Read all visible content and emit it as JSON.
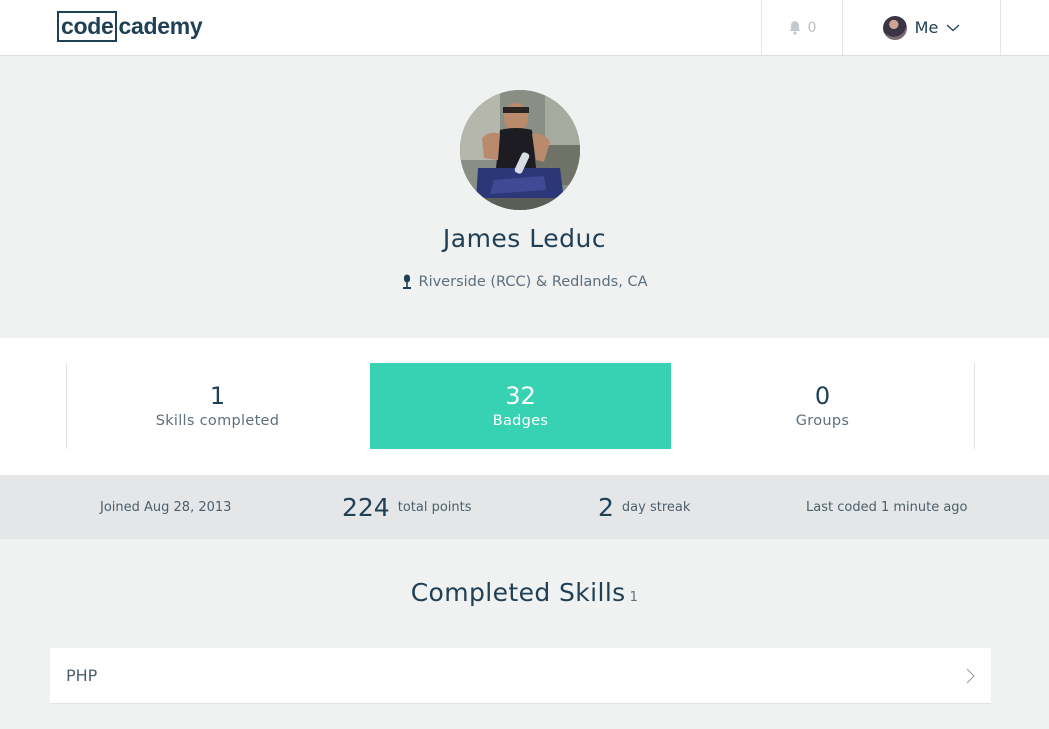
{
  "header": {
    "logo_code": "code",
    "logo_rest": "cademy",
    "notifications_count": "0",
    "me_label": "Me"
  },
  "profile": {
    "name": "James Leduc",
    "location": "Riverside (RCC) & Redlands, CA"
  },
  "stats": [
    {
      "value": "1",
      "label": "Skills completed",
      "active": false
    },
    {
      "value": "32",
      "label": "Badges",
      "active": true
    },
    {
      "value": "0",
      "label": "Groups",
      "active": false
    }
  ],
  "meta": {
    "joined": "Joined Aug 28, 2013",
    "points_value": "224",
    "points_label": "total points",
    "streak_value": "2",
    "streak_label": "day streak",
    "last_coded": "Last coded 1 minute ago"
  },
  "completed_skills": {
    "title": "Completed Skills",
    "count": "1",
    "items": [
      {
        "name": "PHP"
      }
    ]
  },
  "colors": {
    "accent": "#37d2b4",
    "brand": "#204056",
    "background": "#f0f1f1"
  }
}
